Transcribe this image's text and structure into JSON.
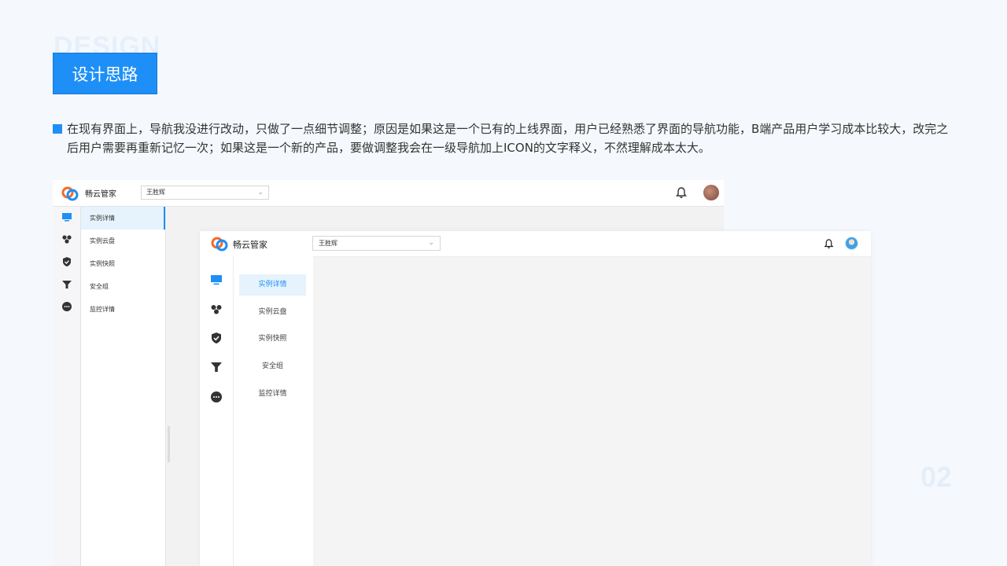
{
  "background_word": "DESIGN",
  "section_title": "设计思路",
  "description": "在现有界面上，导航我没进行改动，只做了一点细节调整；原因是如果这是一个已有的上线界面，用户已经熟悉了界面的导航功能，B端产品用户学习成本比较大，改完之后用户需要再重新记忆一次；如果这是一个新的产品，要做调整我会在一级导航加上ICON的文字释义，不然理解成本太大。",
  "page_number": "02",
  "colors": {
    "accent": "#1e8ff7",
    "active_bg": "#e6f3fd",
    "slide_bg": "#f5f9fd"
  },
  "old_ui": {
    "brand": "畅云管家",
    "account_select": "王胜辉",
    "rail_icons": [
      "monitor-icon",
      "cluster-icon",
      "shield-check-icon",
      "filter-icon",
      "chat-icon"
    ],
    "menu": [
      "实例详情",
      "实例云盘",
      "实例快照",
      "安全组",
      "监控详情"
    ],
    "active_index": 0
  },
  "new_ui": {
    "brand": "畅云管家",
    "account_select": "王胜辉",
    "rail_icons": [
      "monitor-icon",
      "cluster-icon",
      "shield-check-icon",
      "filter-icon",
      "chat-icon"
    ],
    "menu": [
      "实例详情",
      "实例云盘",
      "实例快照",
      "安全组",
      "监控详情"
    ],
    "active_index": 0
  }
}
